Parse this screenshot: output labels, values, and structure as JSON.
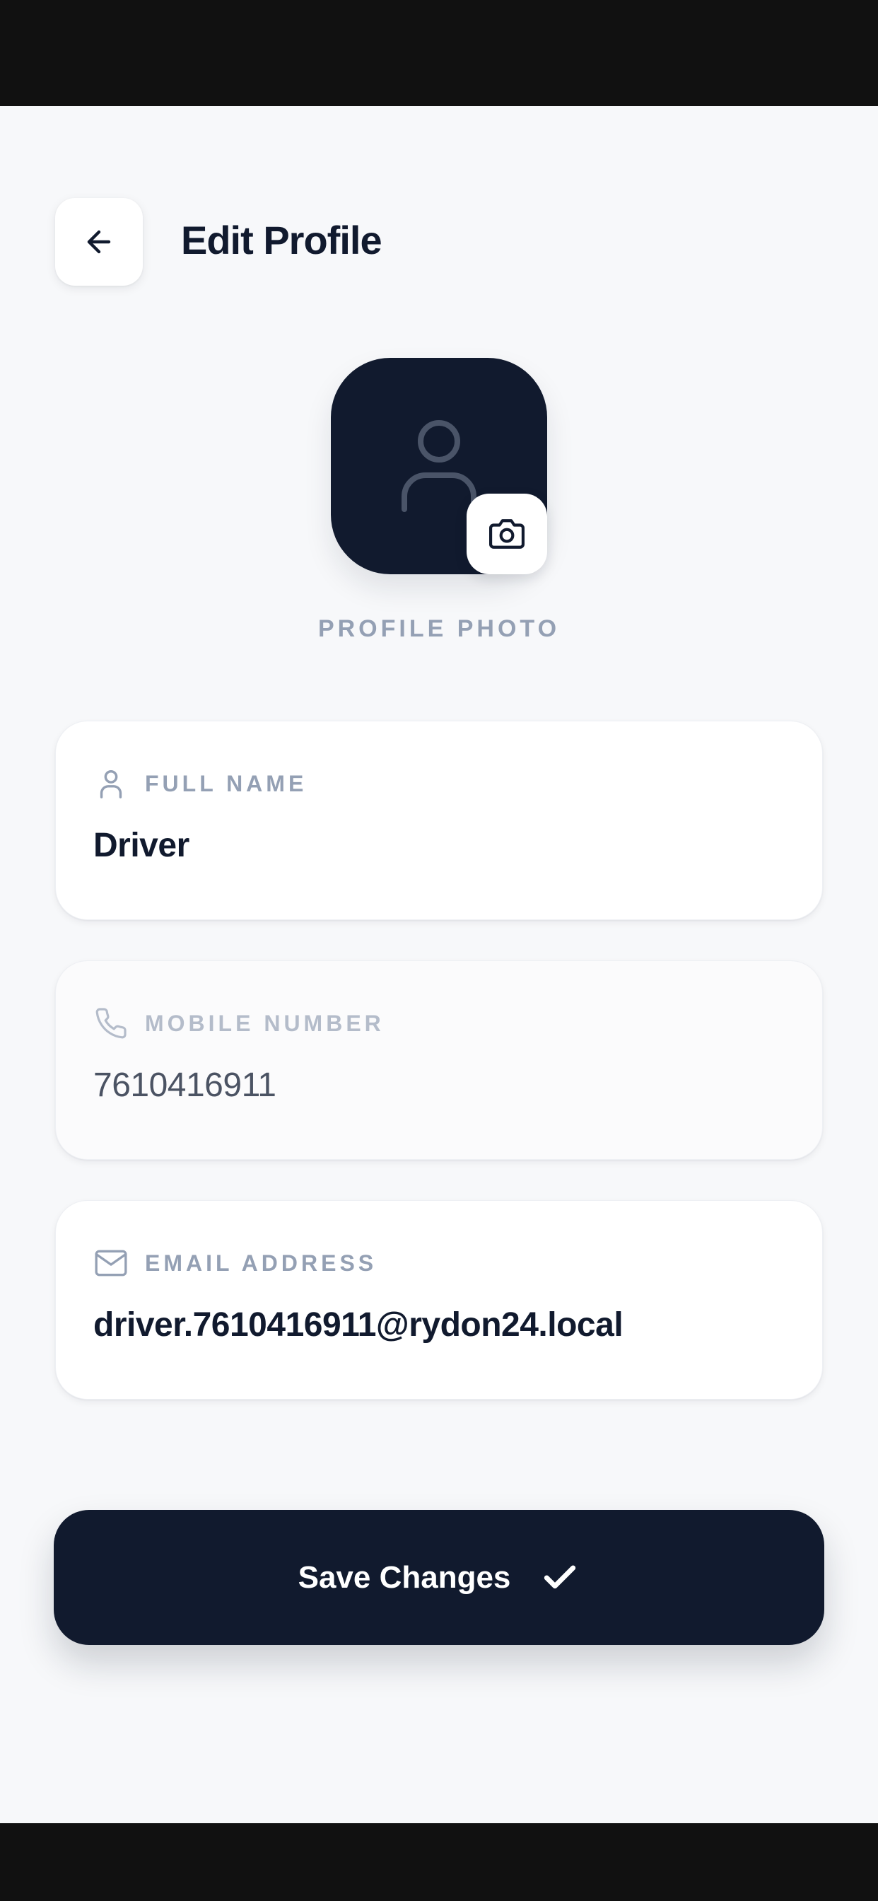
{
  "header": {
    "title": "Edit Profile",
    "back_icon": "arrow-left-icon"
  },
  "profile_photo": {
    "label": "PROFILE PHOTO",
    "placeholder_icon": "user-icon",
    "camera_icon": "camera-icon"
  },
  "fields": [
    {
      "label": "FULL NAME",
      "value": "Driver",
      "icon": "user-icon",
      "editable": true
    },
    {
      "label": "MOBILE NUMBER",
      "value": "7610416911",
      "icon": "phone-icon",
      "editable": false
    },
    {
      "label": "EMAIL ADDRESS",
      "value": "driver.7610416911@rydon24.local",
      "icon": "mail-icon",
      "editable": true
    }
  ],
  "save_button": {
    "label": "Save Changes",
    "icon": "check-icon"
  },
  "colors": {
    "primary": "#111a2e",
    "background": "#f7f8fa",
    "label": "#94a0b4"
  }
}
